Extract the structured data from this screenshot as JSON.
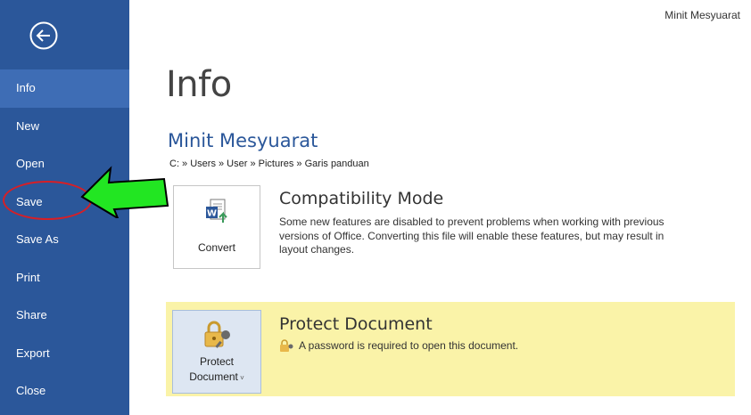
{
  "window": {
    "document_name": "Minit Mesyuarat"
  },
  "sidebar": {
    "items": [
      {
        "label": "Info",
        "active": true
      },
      {
        "label": "New"
      },
      {
        "label": "Open"
      },
      {
        "label": "Save"
      },
      {
        "label": "Save As"
      },
      {
        "label": "Print"
      },
      {
        "label": "Share"
      },
      {
        "label": "Export"
      },
      {
        "label": "Close"
      }
    ]
  },
  "main": {
    "page_title": "Info",
    "file_title": "Minit Mesyuarat",
    "path": "C: » Users » User » Pictures » Garis panduan",
    "compatibility": {
      "button_label": "Convert",
      "heading": "Compatibility Mode",
      "description_lines": [
        "Some new features are disabled to prevent problems when working with previous",
        "versions of Office. Converting this file will enable these features, but may result in",
        "layout changes."
      ]
    },
    "protect": {
      "button_label_line1": "Protect",
      "button_label_line2": "Document",
      "heading": "Protect Document",
      "note": "A password is required to open this document."
    }
  },
  "colors": {
    "sidebar_bg": "#2b579a",
    "sidebar_active": "#3e6db5",
    "protect_bg": "#faf3a8",
    "annotation_red": "#d71f26",
    "annotation_green": "#22e622"
  }
}
